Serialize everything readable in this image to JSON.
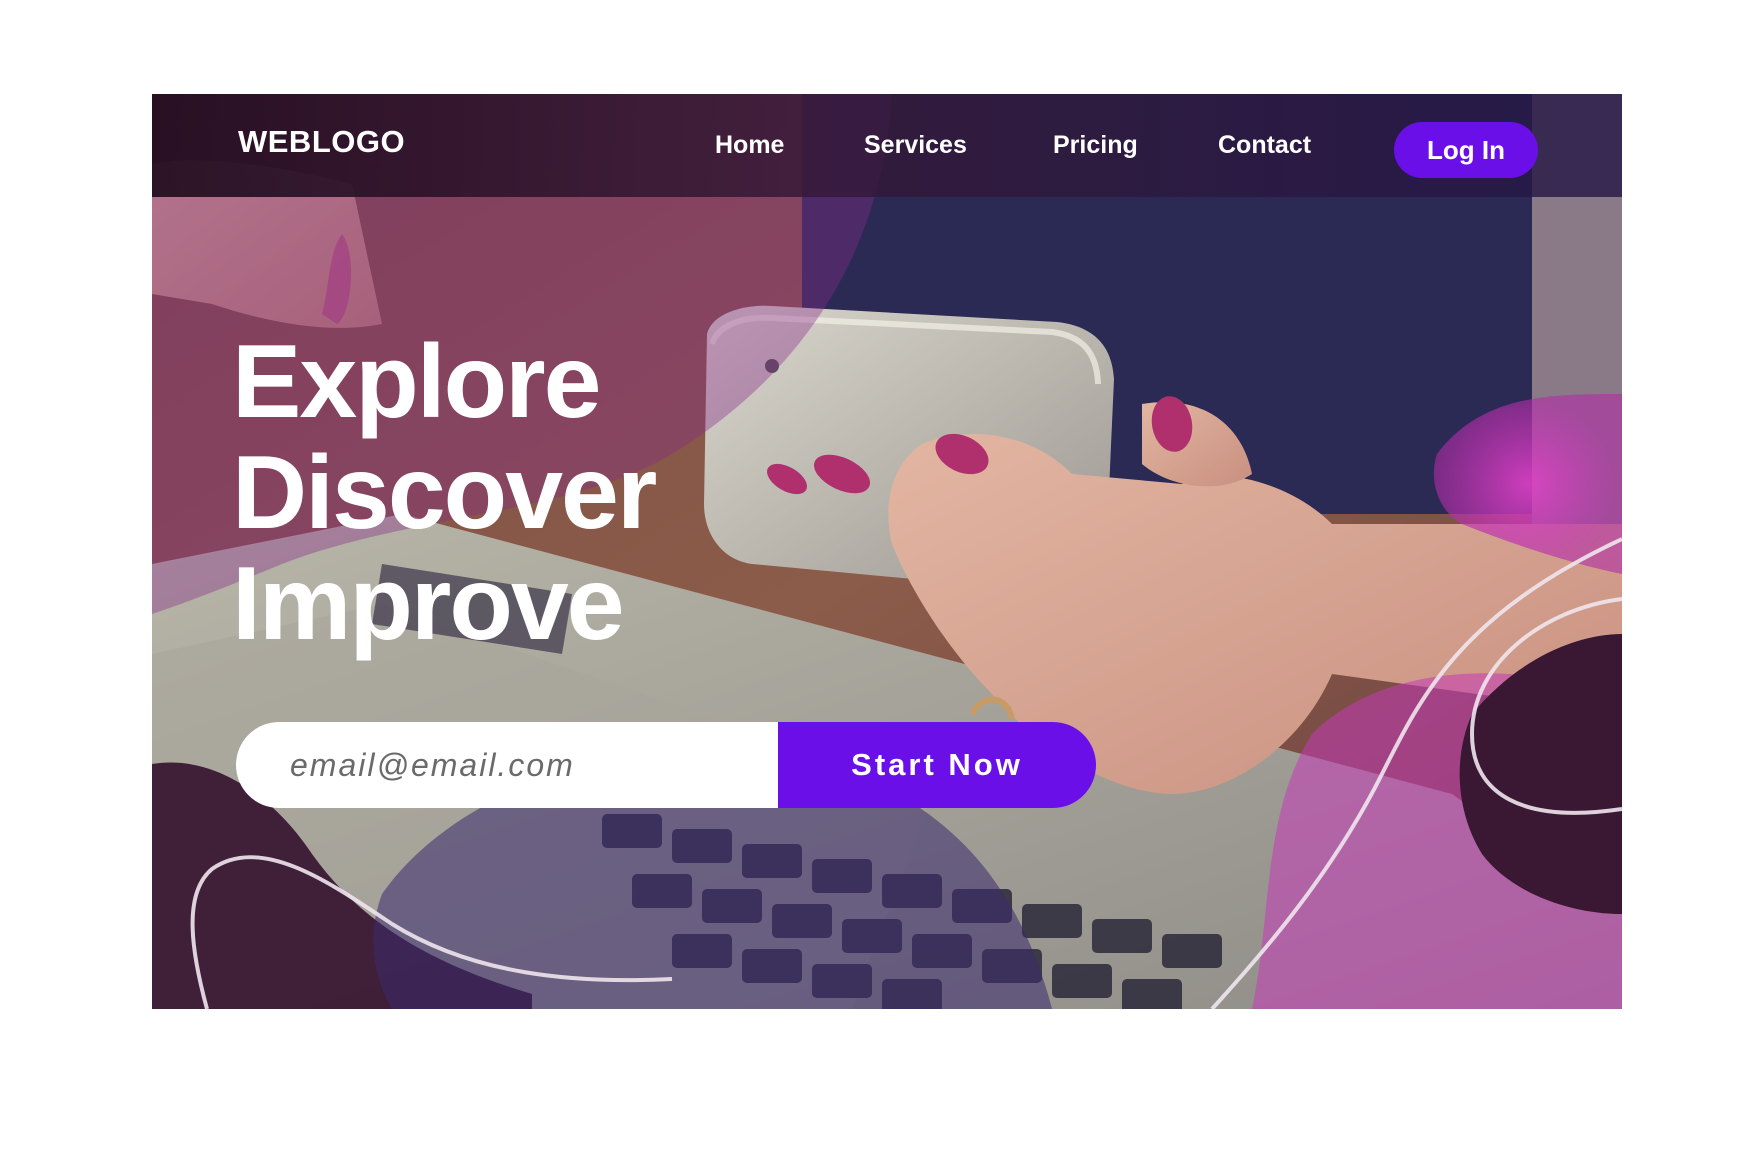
{
  "navbar": {
    "logo": "WEBLOGO",
    "items": [
      {
        "label": "Home"
      },
      {
        "label": "Services"
      },
      {
        "label": "Pricing"
      },
      {
        "label": "Contact"
      }
    ],
    "login_label": "Log In"
  },
  "hero": {
    "headline_lines": [
      "Explore",
      "Discover",
      "Improve"
    ],
    "image_icon": "hand-holding-phone-over-laptop-photo"
  },
  "signup": {
    "email_placeholder": "email@email.com",
    "email_value": "",
    "start_label": "Start Now"
  },
  "colors": {
    "accent": "#6a0fe8",
    "overlay_dark": "#3a1833",
    "overlay_magenta": "#c13ab4",
    "page_background": "#ffffff"
  }
}
